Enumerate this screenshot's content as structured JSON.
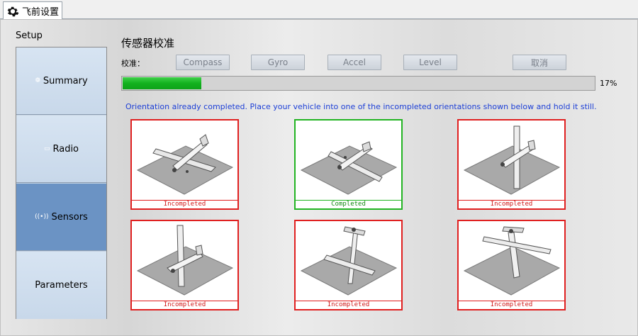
{
  "tab": {
    "label": "飞前设置",
    "icon": "gear-icon"
  },
  "sidebar": {
    "title": "Setup",
    "items": [
      {
        "label": "Summary",
        "icon": "summary-icon",
        "active": false
      },
      {
        "label": "Radio",
        "icon": "radio-icon",
        "active": false
      },
      {
        "label": "Sensors",
        "icon": "sensors-icon",
        "active": true
      },
      {
        "label": "Parameters",
        "icon": "",
        "active": false
      }
    ]
  },
  "main": {
    "title": "传感器校准",
    "calibrate_label": "校准：",
    "buttons": {
      "compass": "Compass",
      "gyro": "Gyro",
      "accel": "Accel",
      "level": "Level",
      "cancel": "取消"
    },
    "progress": {
      "value": 17,
      "text": "17%"
    },
    "message": "Orientation already completed. Place your vehicle into one of the incompleted orientations shown below and hold it still.",
    "orientations": [
      {
        "status": "Incompleted"
      },
      {
        "status": "Completed"
      },
      {
        "status": "Incompleted"
      },
      {
        "status": "Incompleted"
      },
      {
        "status": "Incompleted"
      },
      {
        "status": "Incompleted"
      }
    ]
  },
  "colors": {
    "incomplete": "#e02020",
    "complete": "#22b422",
    "active_nav": "#6b93c4",
    "progress": "#12b11e",
    "message": "#1d3fd6"
  }
}
